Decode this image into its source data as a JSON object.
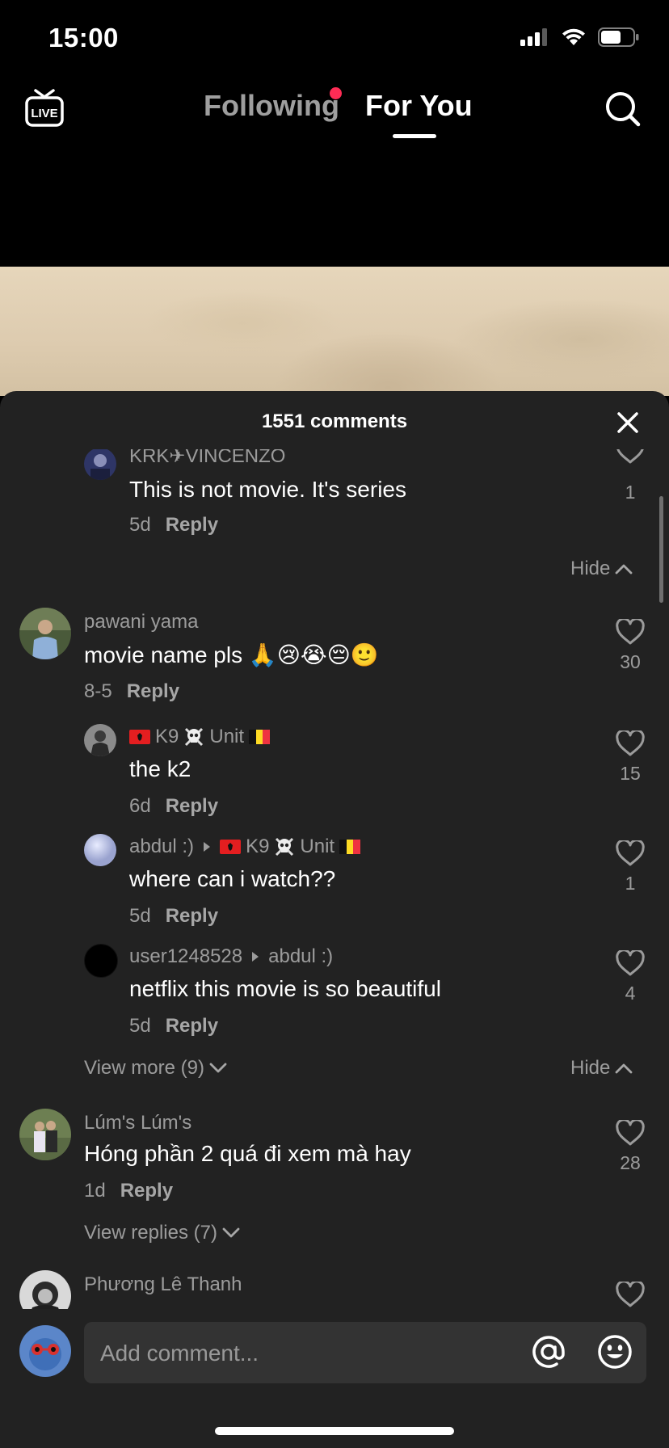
{
  "status_bar": {
    "time": "15:00"
  },
  "nav": {
    "live_label": "LIVE",
    "tabs": [
      {
        "label": "Following"
      },
      {
        "label": "For You"
      }
    ]
  },
  "sheet": {
    "title": "1551 comments"
  },
  "comments": {
    "c0": {
      "username": "KRK✈VINCENZO",
      "text": "This is not movie. It's series",
      "date": "5d",
      "reply": "Reply",
      "likes": "1"
    },
    "hide1": "Hide",
    "c1": {
      "username": "pawani yama",
      "text": "movie name pls 🙏😢😭😔🙂",
      "date": "8-5",
      "reply": "Reply",
      "likes": "30"
    },
    "c1r1": {
      "username": "K9",
      "username_tail": "Unit",
      "text": "the k2",
      "date": "6d",
      "reply": "Reply",
      "likes": "15"
    },
    "c1r2": {
      "username": "abdul :)",
      "reply_to": "K9",
      "reply_to_tail": "Unit",
      "text": "where can i watch??",
      "date": "5d",
      "reply": "Reply",
      "likes": "1"
    },
    "c1r3": {
      "username": "user1248528",
      "reply_to": "abdul :)",
      "text": "netflix this movie is so beautiful",
      "date": "5d",
      "reply": "Reply",
      "likes": "4"
    },
    "view_more": "View more (9)",
    "hide2": "Hide",
    "c2": {
      "username": "Lúm's Lúm's",
      "text": "Hóng phần 2 quá đi xem mà hay",
      "date": "1d",
      "reply": "Reply",
      "likes": "28"
    },
    "view_replies": "View replies (7)",
    "c3": {
      "username": "Phương Lê Thanh"
    }
  },
  "input": {
    "placeholder": "Add comment..."
  },
  "colors": {
    "accent_dot": "#fe2c55",
    "sheet_bg": "#222222",
    "input_bg": "#333333"
  },
  "icons": [
    "live-icon",
    "search-icon",
    "close-icon",
    "heart-icon",
    "chevron-up-icon",
    "chevron-down-icon",
    "at-sign-icon",
    "smiley-icon",
    "skull-icon",
    "albania-flag-icon",
    "belgium-flag-icon"
  ]
}
